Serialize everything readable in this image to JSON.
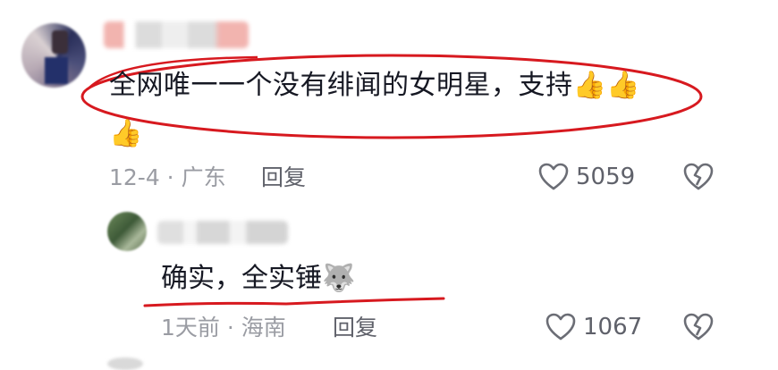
{
  "comment": {
    "text": "全网唯一一个没有绯闻的女明星，支持",
    "emoji_a": "👍",
    "emoji_b": "👍",
    "emoji_c": "👍",
    "meta": "12-4 · 广东",
    "reply_label": "回复",
    "likes": "5059"
  },
  "reply": {
    "text": "确实，全实锤",
    "emoji": "🐺",
    "meta": "1天前 · 海南",
    "reply_label": "回复",
    "likes": "1067"
  },
  "colors": {
    "annotation_red": "#d7191f",
    "meta_gray": "#9a9ca3",
    "action_gray": "#5f616a"
  },
  "icons": [
    "heart-outline-icon",
    "broken-heart-icon",
    "thumbs-up-emoji",
    "husky-emoji"
  ]
}
